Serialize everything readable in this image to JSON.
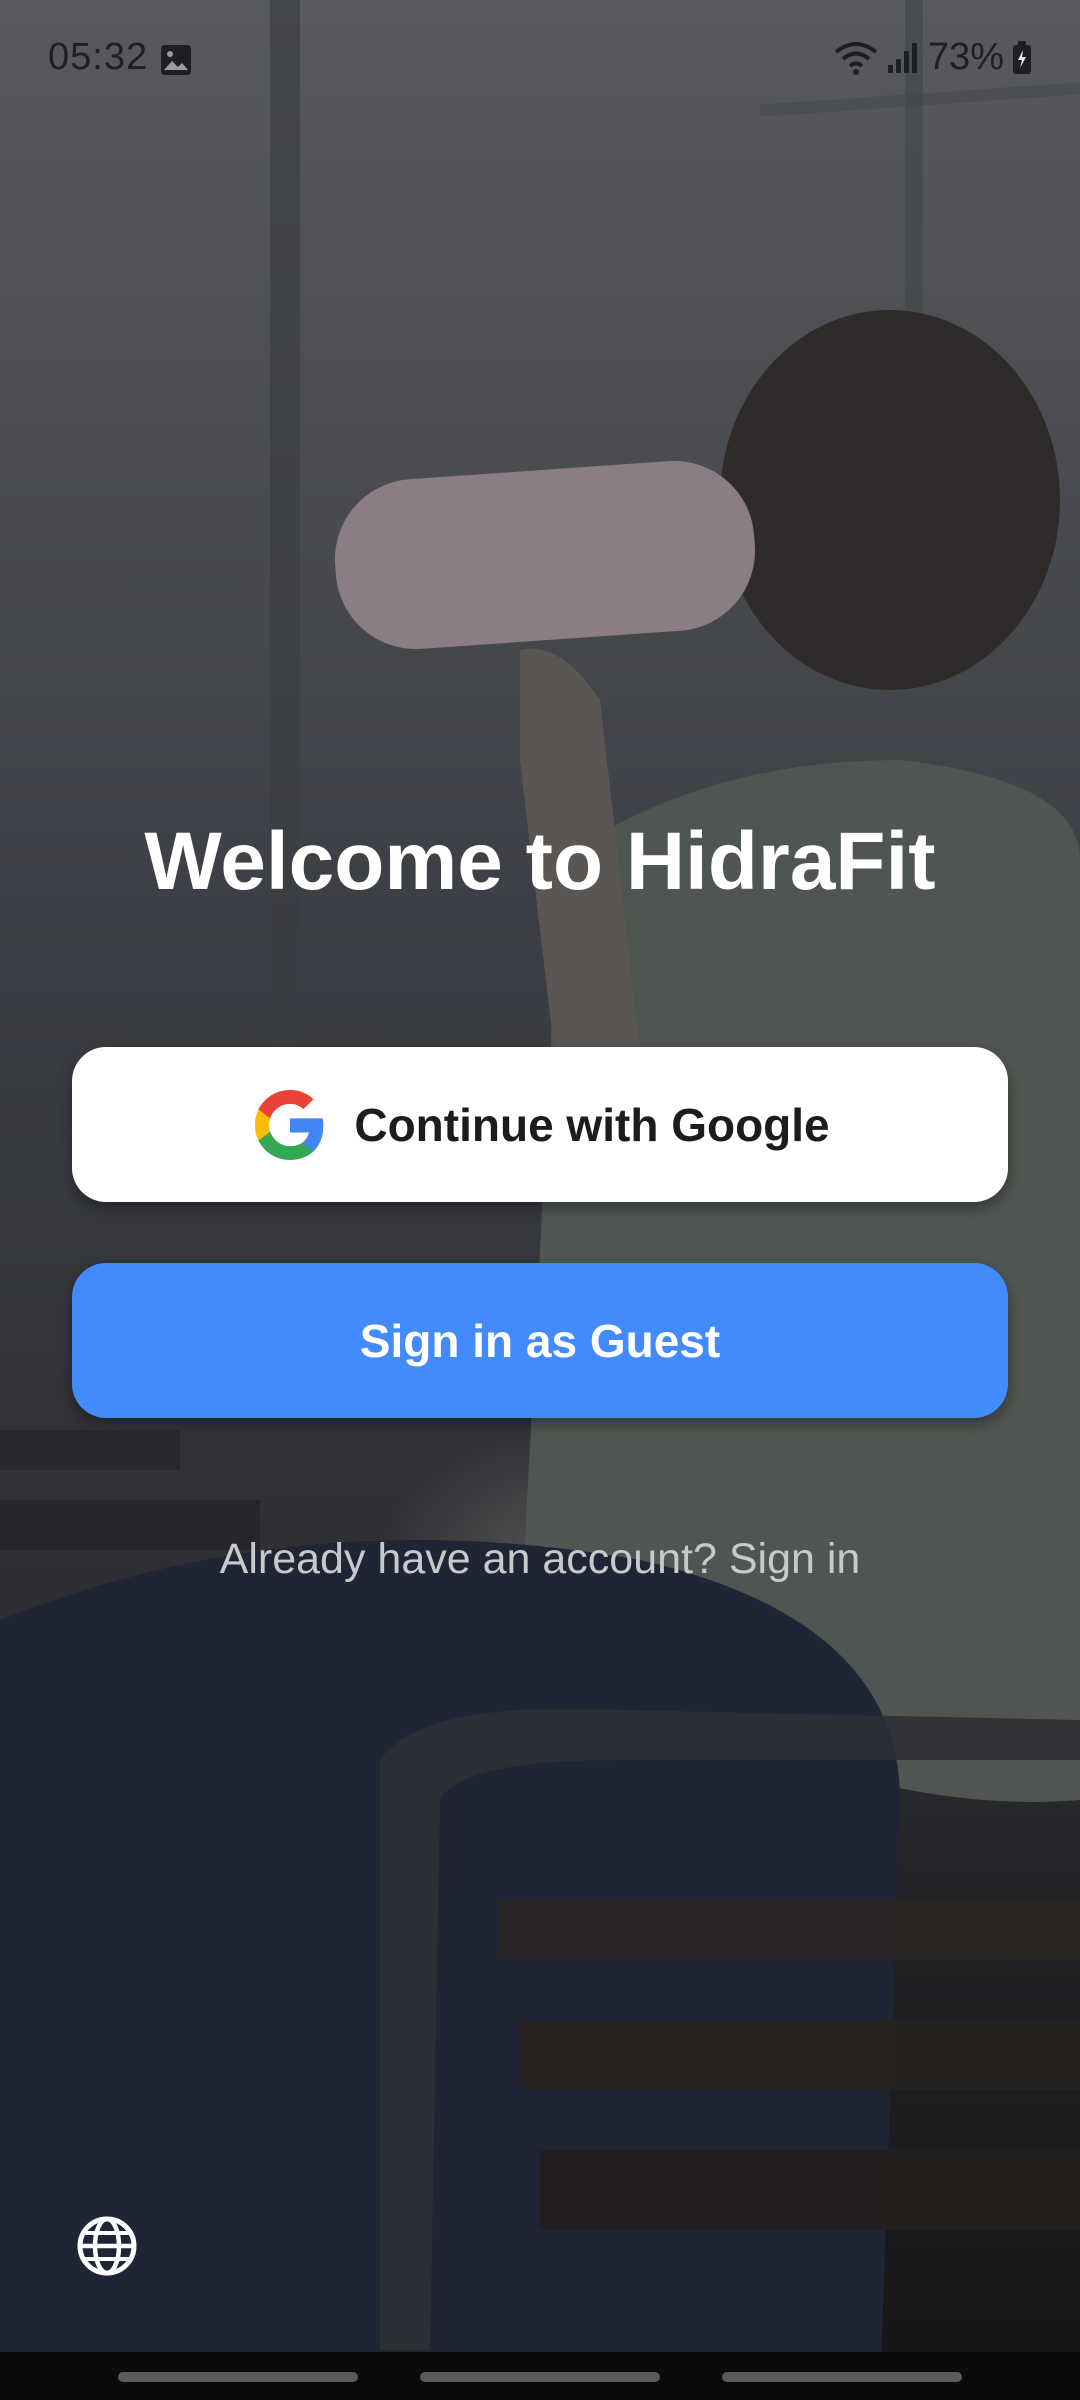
{
  "status_bar": {
    "time": "05:32",
    "battery": "73%"
  },
  "welcome": {
    "title": "Welcome to HidraFit"
  },
  "actions": {
    "google_label": "Continue with Google",
    "guest_label": "Sign in as Guest",
    "signin_prompt": "Already have an account? Sign in"
  },
  "colors": {
    "guest_button": "#438afc",
    "google_button": "#ffffff",
    "title_text": "#ffffff"
  },
  "icons": {
    "status_left": "image-icon",
    "status_right": [
      "wifi-icon",
      "signal-icon",
      "battery-icon"
    ],
    "google": "google-logo-icon",
    "language": "globe-icon"
  }
}
